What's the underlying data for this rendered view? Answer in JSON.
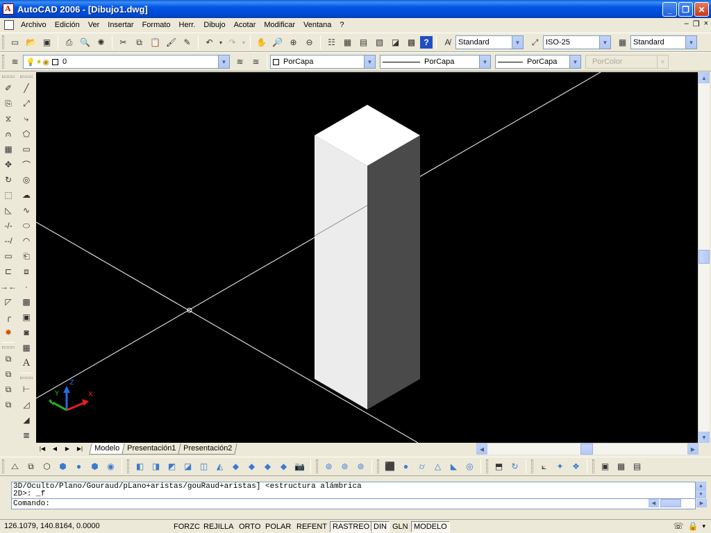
{
  "window": {
    "title": "AutoCAD 2006 - [Dibujo1.dwg]",
    "buttons": {
      "minimize": "_",
      "maximize": "❐",
      "close": "✕"
    }
  },
  "menu": {
    "items": [
      "Archivo",
      "Edición",
      "Ver",
      "Insertar",
      "Formato",
      "Herr.",
      "Dibujo",
      "Acotar",
      "Modificar",
      "Ventana",
      "?"
    ],
    "mdi": {
      "minimize": "–",
      "restore": "❐",
      "close": "×"
    }
  },
  "styles_toolbar": {
    "text_style": "Standard",
    "dim_style": "ISO-25",
    "table_style": "Standard"
  },
  "layers_toolbar": {
    "current_layer": "0",
    "color": "PorCapa",
    "linetype": "PorCapa",
    "lineweight": "PorCapa",
    "plot_style": "PorColor"
  },
  "layout_tabs": {
    "tabs": [
      "Modelo",
      "Presentación1",
      "Presentación2"
    ],
    "active": "Modelo"
  },
  "ucs": {
    "x": "X",
    "y": "Y",
    "z": "Z"
  },
  "command": {
    "history_line1": "3D/Oculto/Plano/Gouraud/pLano+aristas/gouRaud+aristas] <estructura alámbrica",
    "history_line2": "2D>: _f",
    "prompt": "Comando:"
  },
  "status": {
    "coordinates": "126.1079, 140.8164, 0.0000",
    "toggles": [
      {
        "label": "FORZC",
        "on": false
      },
      {
        "label": "REJILLA",
        "on": false
      },
      {
        "label": "ORTO",
        "on": false
      },
      {
        "label": "POLAR",
        "on": false
      },
      {
        "label": "REFENT",
        "on": false
      },
      {
        "label": "RASTREO",
        "on": true
      },
      {
        "label": "DIN",
        "on": true
      },
      {
        "label": "GLN",
        "on": false
      },
      {
        "label": "MODELO",
        "on": true
      }
    ]
  },
  "colors": {
    "canvas_bg": "#000000",
    "box_top": "#ffffff",
    "box_left": "#ececec",
    "box_right": "#4a4a4a",
    "axis_line": "#ffffff",
    "ucs_x": "#e02020",
    "ucs_y": "#20b020",
    "ucs_z": "#2a6ae0"
  }
}
